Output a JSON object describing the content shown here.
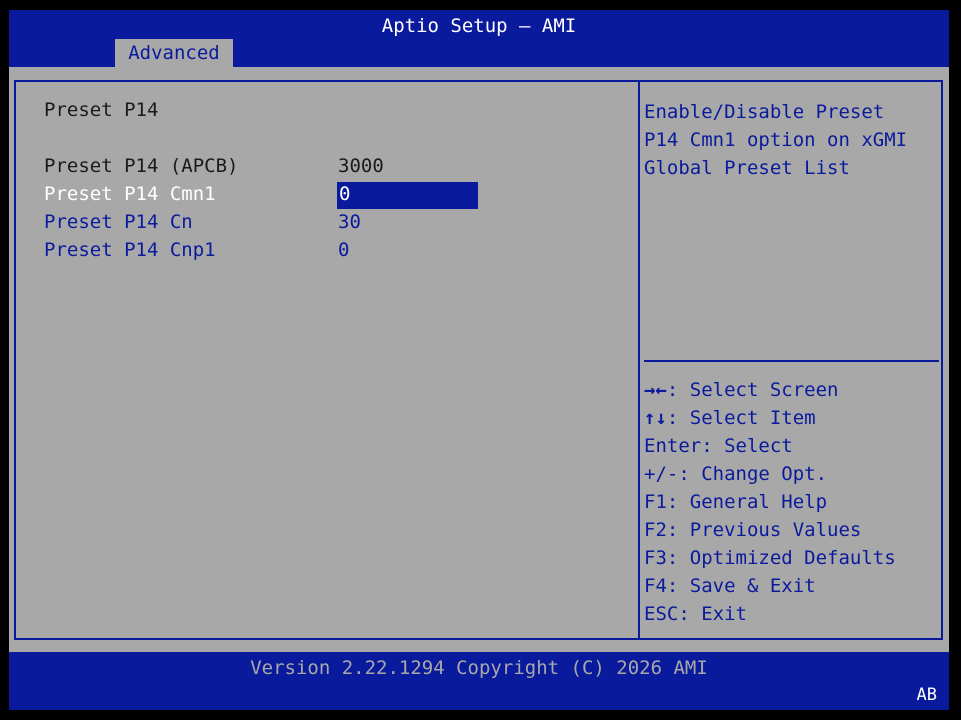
{
  "header": {
    "title": "Aptio Setup – AMI",
    "tab": "Advanced"
  },
  "main": {
    "section_title": "Preset P14",
    "rows": [
      {
        "label": "Preset P14 (APCB)",
        "value": "3000"
      },
      {
        "label": "Preset P14 Cmn1",
        "value": "0"
      },
      {
        "label": "Preset P14 Cn",
        "value": "30"
      },
      {
        "label": "Preset P14 Cnp1",
        "value": "0"
      }
    ]
  },
  "help": {
    "text": "Enable/Disable Preset\nP14 Cmn1 option on xGMI\nGlobal Preset List"
  },
  "keys": [
    {
      "key": "→←",
      "sep": ": ",
      "desc": "Select Screen"
    },
    {
      "key": "↑↓",
      "sep": ": ",
      "desc": "Select Item"
    },
    {
      "key": "Enter",
      "sep": ": ",
      "desc": "Select"
    },
    {
      "key": "+/-",
      "sep": ": ",
      "desc": "Change Opt."
    },
    {
      "key": "F1",
      "sep": ": ",
      "desc": "General Help"
    },
    {
      "key": "F2",
      "sep": ": ",
      "desc": "Previous Values"
    },
    {
      "key": "F3",
      "sep": ": ",
      "desc": "Optimized Defaults"
    },
    {
      "key": "F4",
      "sep": ": ",
      "desc": "Save & Exit"
    },
    {
      "key": "ESC",
      "sep": ": ",
      "desc": "Exit"
    }
  ],
  "footer": {
    "version": "Version 2.22.1294 Copyright (C) 2026 AMI",
    "corner": "AB"
  },
  "colors": {
    "bios_blue": "#0a1a9c",
    "panel_gray": "#a8a8a8",
    "text_dark": "#1a1a1a",
    "highlight_text": "#ffffff"
  }
}
